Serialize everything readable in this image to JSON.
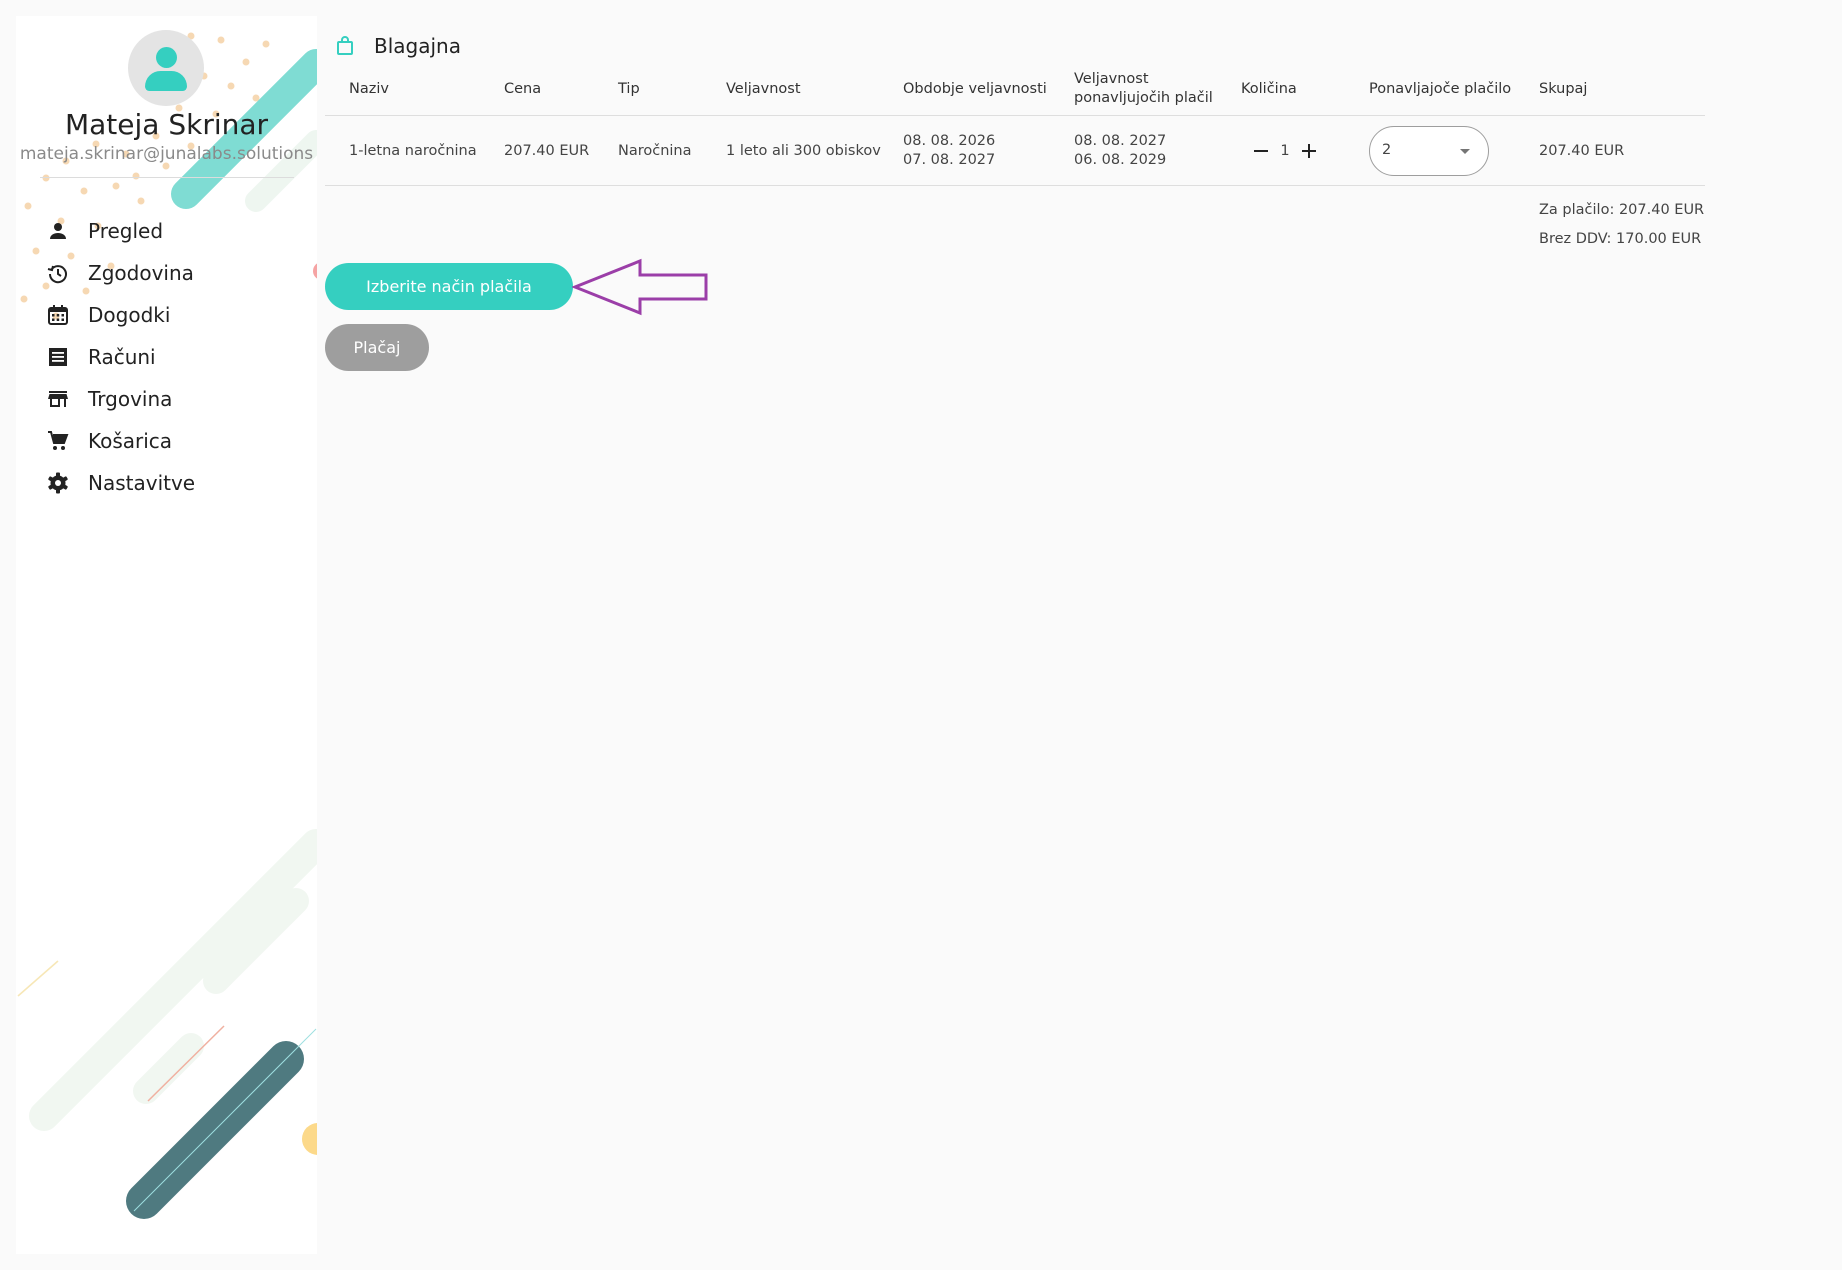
{
  "sidebar": {
    "user": {
      "name": "Mateja Skrinar",
      "email": "mateja.skrinar@junalabs.solutions"
    },
    "items": [
      {
        "label": "Pregled",
        "icon": "person-icon"
      },
      {
        "label": "Zgodovina",
        "icon": "history-icon"
      },
      {
        "label": "Dogodki",
        "icon": "calendar-icon"
      },
      {
        "label": "Računi",
        "icon": "receipt-icon"
      },
      {
        "label": "Trgovina",
        "icon": "store-icon"
      },
      {
        "label": "Košarica",
        "icon": "cart-icon"
      },
      {
        "label": "Nastavitve",
        "icon": "gear-icon"
      }
    ]
  },
  "main": {
    "title": "Blagajna",
    "title_icon": "shopping-bag-icon",
    "table": {
      "headers": {
        "name": "Naziv",
        "price": "Cena",
        "type": "Tip",
        "validity": "Veljavnost",
        "period_line1": "Obdobje veljavnosti",
        "recurring_validity_line1": "Veljavnost",
        "recurring_validity_line2": "ponavljujočih plačil",
        "quantity": "Količina",
        "recurring_payment": "Ponavljajoče plačilo",
        "total": "Skupaj"
      },
      "rows": [
        {
          "name": "1-letna naročnina",
          "price": "207.40 EUR",
          "type": "Naročnina",
          "validity": "1 leto ali 300 obiskov",
          "period_from": "08. 08. 2026",
          "period_to": "07. 08. 2027",
          "recurring_from": "08. 08. 2027",
          "recurring_to": "06. 08. 2029",
          "quantity": "1",
          "recurring_payment": "2",
          "total": "207.40 EUR"
        }
      ]
    },
    "totals": {
      "to_pay": "Za plačilo: 207.40 EUR",
      "without_vat": "Brez DDV: 170.00 EUR"
    },
    "buttons": {
      "choose_payment": "Izberite način plačila",
      "pay": "Plačaj"
    }
  },
  "colors": {
    "accent": "#35cfc0",
    "disabled": "#9e9e9e",
    "annotation_arrow": "#9b3ea8",
    "deco_dark": "#4f7a80"
  }
}
